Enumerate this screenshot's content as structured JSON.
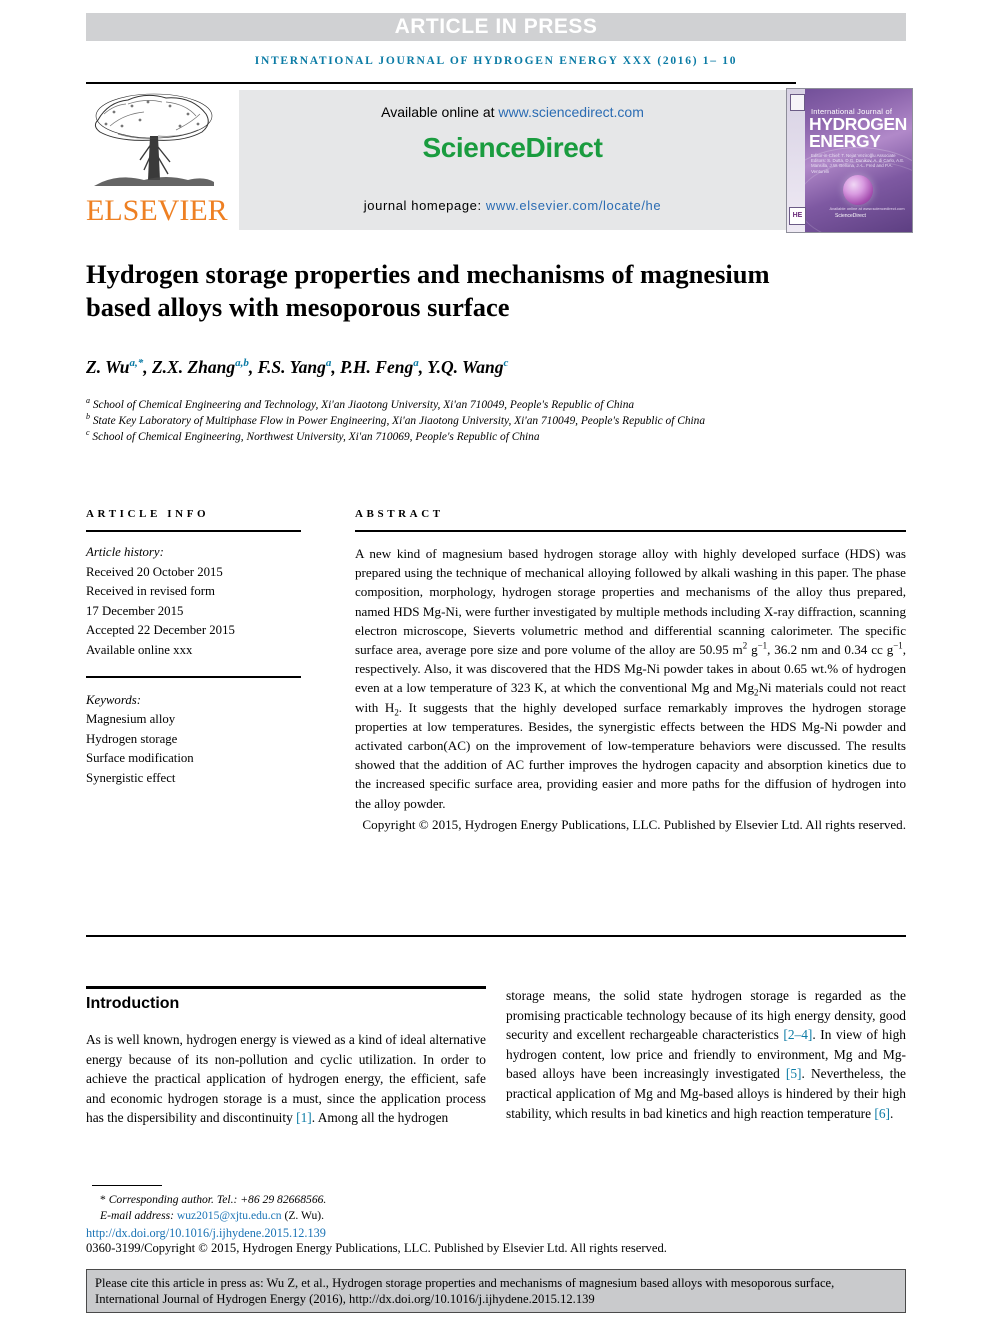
{
  "banner": {
    "article_in_press": "ARTICLE IN PRESS"
  },
  "running_head": "INTERNATIONAL JOURNAL OF HYDROGEN ENERGY XXX (2016) 1– 10",
  "masthead": {
    "publisher_name": "ELSEVIER",
    "available_prefix": "Available online at ",
    "available_url": "www.sciencedirect.com",
    "sciencedirect_wordmark": "ScienceDirect",
    "homepage_prefix": "journal homepage: ",
    "homepage_url": "www.elsevier.com/locate/he",
    "cover": {
      "line_small": "International Journal of",
      "line_1": "HYDROGEN",
      "line_2": "ENERGY",
      "editors": "Editor-in-Chief: T. Nejat Veziroğlu    Associate Editors: S. Dutta, D.G. Dunikov, A. di Carlo, A.E. Mansilla, J.W. Bellona, J.-L. Fred and P.A. Venturelli",
      "available_note": "Available online at www.sciencedirect.com",
      "sciencedirect_note": "ScienceDirect",
      "he_mark": "HE"
    }
  },
  "article": {
    "title": "Hydrogen storage properties and mechanisms of magnesium based alloys with mesoporous surface",
    "authors": [
      {
        "name": "Z. Wu",
        "marks": "a,*"
      },
      {
        "name": "Z.X. Zhang",
        "marks": "a,b"
      },
      {
        "name": "F.S. Yang",
        "marks": "a"
      },
      {
        "name": "P.H. Feng",
        "marks": "a"
      },
      {
        "name": "Y.Q. Wang",
        "marks": "c"
      }
    ],
    "affiliations": [
      {
        "mark": "a",
        "text": "School of Chemical Engineering and Technology, Xi'an Jiaotong University, Xi'an 710049, People's Republic of China"
      },
      {
        "mark": "b",
        "text": "State Key Laboratory of Multiphase Flow in Power Engineering, Xi'an Jiaotong University, Xi'an 710049, People's Republic of China"
      },
      {
        "mark": "c",
        "text": "School of Chemical Engineering, Northwest University, Xi'an 710069, People's Republic of China"
      }
    ]
  },
  "article_info": {
    "heading": "ARTICLE INFO",
    "history_label": "Article history:",
    "history": [
      "Received 20 October 2015",
      "Received in revised form",
      "17 December 2015",
      "Accepted 22 December 2015",
      "Available online xxx"
    ],
    "keywords_label": "Keywords:",
    "keywords": [
      "Magnesium alloy",
      "Hydrogen storage",
      "Surface modification",
      "Synergistic effect"
    ]
  },
  "abstract": {
    "heading": "ABSTRACT",
    "body_part1": "A new kind of magnesium based hydrogen storage alloy with highly developed surface (HDS) was prepared using the technique of mechanical alloying followed by alkali washing in this paper. The phase composition, morphology, hydrogen storage properties and mechanisms of the alloy thus prepared, named HDS Mg-Ni, were further investigated by multiple methods including X-ray diffraction, scanning electron microscope, Sieverts volumetric method and differential scanning calorimeter. The specific surface area, average pore size and pore volume of the alloy are 50.95 m",
    "unit1_sup": "2",
    "body_part2": " g",
    "unit2_sup": "−1",
    "body_part3": ", 36.2 nm and 0.34 cc g",
    "unit3_sup": "−1",
    "body_part4": ", respectively. Also, it was discovered that the HDS Mg-Ni powder takes in about 0.65 wt.% of hydrogen even at a low temperature of 323 K, at which the conventional Mg and Mg",
    "sub1": "2",
    "body_part5": "Ni materials could not react with H",
    "sub2": "2",
    "body_part6": ". It suggests that the highly developed surface remarkably improves the hydrogen storage properties at low temperatures. Besides, the synergistic effects between the HDS Mg-Ni powder and activated carbon(AC) on the improvement of low-temperature behaviors were discussed. The results showed that the addition of AC further improves the hydrogen capacity and absorption kinetics due to the increased specific surface area, providing easier and more paths for the diffusion of hydrogen into the alloy powder.",
    "copyright": "Copyright © 2015, Hydrogen Energy Publications, LLC. Published by Elsevier Ltd. All rights reserved."
  },
  "introduction": {
    "heading": "Introduction",
    "col_left_part1": "As is well known, hydrogen energy is viewed as a kind of ideal alternative energy because of its non-pollution and cyclic utilization. In order to achieve the practical application of hydrogen energy, the efficient, safe and economic hydrogen storage is a must, since the application process has the dispersibility and discontinuity ",
    "ref1": "[1]",
    "col_left_part2": ". Among all the hydrogen",
    "col_right_part1": "storage means, the solid state hydrogen storage is regarded as the promising practicable technology because of its high energy density, good security and excellent rechargeable characteristics ",
    "ref2": "[2–4]",
    "col_right_part2": ". In view of high hydrogen content, low price and friendly to environment, Mg and Mg-based alloys have been increasingly investigated ",
    "ref3": "[5]",
    "col_right_part3": ". Nevertheless, the practical application of Mg and Mg-based alloys is hindered by their high stability, which results in bad kinetics and high reaction temperature ",
    "ref4": "[6]",
    "col_right_part4": "."
  },
  "footnote": {
    "corresponding": "Corresponding author. Tel.: +86 29 82668566.",
    "email_label": "E-mail address: ",
    "email": "wuz2015@xjtu.edu.cn",
    "email_suffix": " (Z. Wu).",
    "doi_url": "http://dx.doi.org/10.1016/j.ijhydene.2015.12.139",
    "issn_line": "0360-3199/Copyright © 2015, Hydrogen Energy Publications, LLC. Published by Elsevier Ltd. All rights reserved."
  },
  "cite_box": {
    "text": "Please cite this article in press as: Wu Z, et al., Hydrogen storage properties and mechanisms of magnesium based alloys with mesoporous surface, International Journal of Hydrogen Energy (2016), http://dx.doi.org/10.1016/j.ijhydene.2015.12.139"
  },
  "colors": {
    "banner_gray": "#d0d1d3",
    "link_blue": "#2b6cb3",
    "header_teal": "#0b7ba5",
    "sciencedirect_green": "#1a9c3f",
    "elsevier_orange": "#ee8023",
    "cite_box_gray": "#c9cacc"
  }
}
